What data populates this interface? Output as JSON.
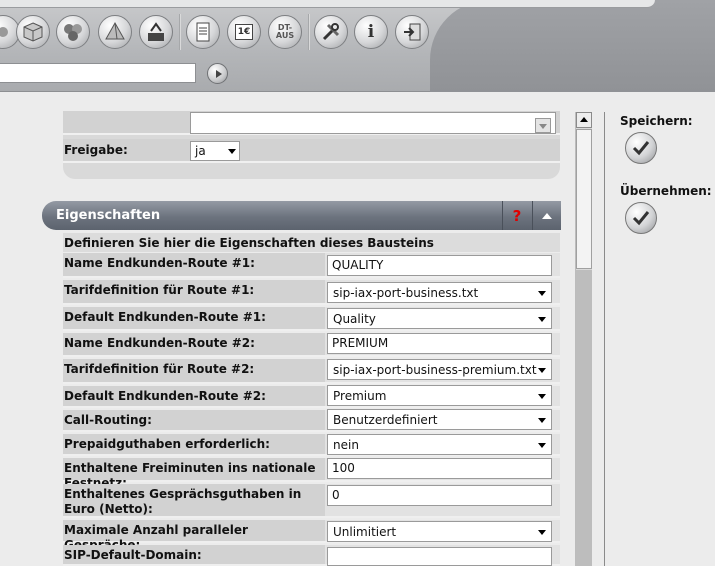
{
  "toolbar": {
    "dt_label_top": "DT-",
    "dt_label_bottom": "AUS",
    "invoice_label": "1€",
    "info_label": "i",
    "address_value": ""
  },
  "form_top": {
    "empty_select_value": "",
    "freigabe_label": "Freigabe:",
    "freigabe_value": "ja"
  },
  "section": {
    "title": "Eigenschaften",
    "help_symbol": "?",
    "description": "Definieren Sie hier die Eigenschaften dieses Bausteins"
  },
  "properties": [
    {
      "label": "Name Endkunden-Route #1:",
      "value": "QUALITY"
    },
    {
      "label": "Tarifdefinition für Route #1:",
      "value": "sip-iax-port-business.txt"
    },
    {
      "label": "Default Endkunden-Route #1:",
      "value": "Quality"
    },
    {
      "label": "Name Endkunden-Route #2:",
      "value": "PREMIUM"
    },
    {
      "label": "Tarifdefinition für Route #2:",
      "value": "sip-iax-port-business-premium.txt"
    },
    {
      "label": "Default Endkunden-Route #2:",
      "value": "Premium"
    },
    {
      "label": "Call-Routing:",
      "value": "Benutzerdefiniert"
    },
    {
      "label": "Prepaidguthaben erforderlich:",
      "value": "nein"
    },
    {
      "label": "Enthaltene Freiminuten ins nationale Festnetz:",
      "value": "100"
    },
    {
      "label": "Enthaltenes Gesprächsguthaben in Euro (Netto):",
      "value": "0"
    },
    {
      "label": "Maximale Anzahl paralleler Gespräche:",
      "value": "Unlimitiert"
    },
    {
      "label": "SIP-Default-Domain:",
      "value": ""
    }
  ],
  "actions": {
    "save_label": "Speichern:",
    "apply_label": "Übernehmen:"
  },
  "colors": {
    "header_bg": "#6c737e",
    "help_red": "#e00000",
    "row_bg": "#d2d2d2"
  }
}
